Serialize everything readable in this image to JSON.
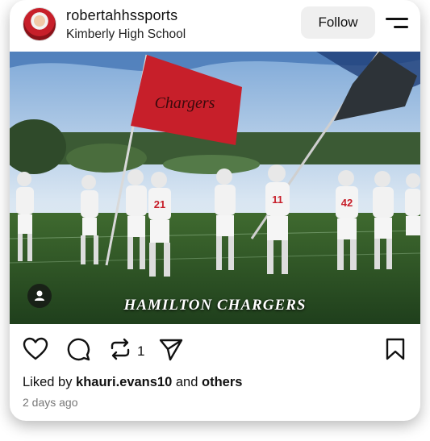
{
  "post": {
    "username": "robertahhssports",
    "subtitle": "Kimberly High School",
    "follow_label": "Follow",
    "menu_icon": "menu-lines-icon",
    "image_caption": "HAMILTON CHARGERS",
    "flag_text": "Chargers",
    "jersey_numbers": [
      "21",
      "11",
      "42"
    ],
    "repost_count": "1",
    "liked_prefix": "Liked by ",
    "liked_user": "khauri.evans10",
    "liked_middle": " and ",
    "liked_others": "others",
    "timestamp": "2 days ago",
    "icons": [
      "heart-icon",
      "comment-icon",
      "repost-icon",
      "send-icon",
      "bookmark-icon",
      "person-tag-icon"
    ],
    "colors": {
      "team_red": "#c71f2a",
      "field_green": "#2e5b2a",
      "text": "#111111",
      "muted": "#777777",
      "follow_bg": "#efefef"
    }
  }
}
